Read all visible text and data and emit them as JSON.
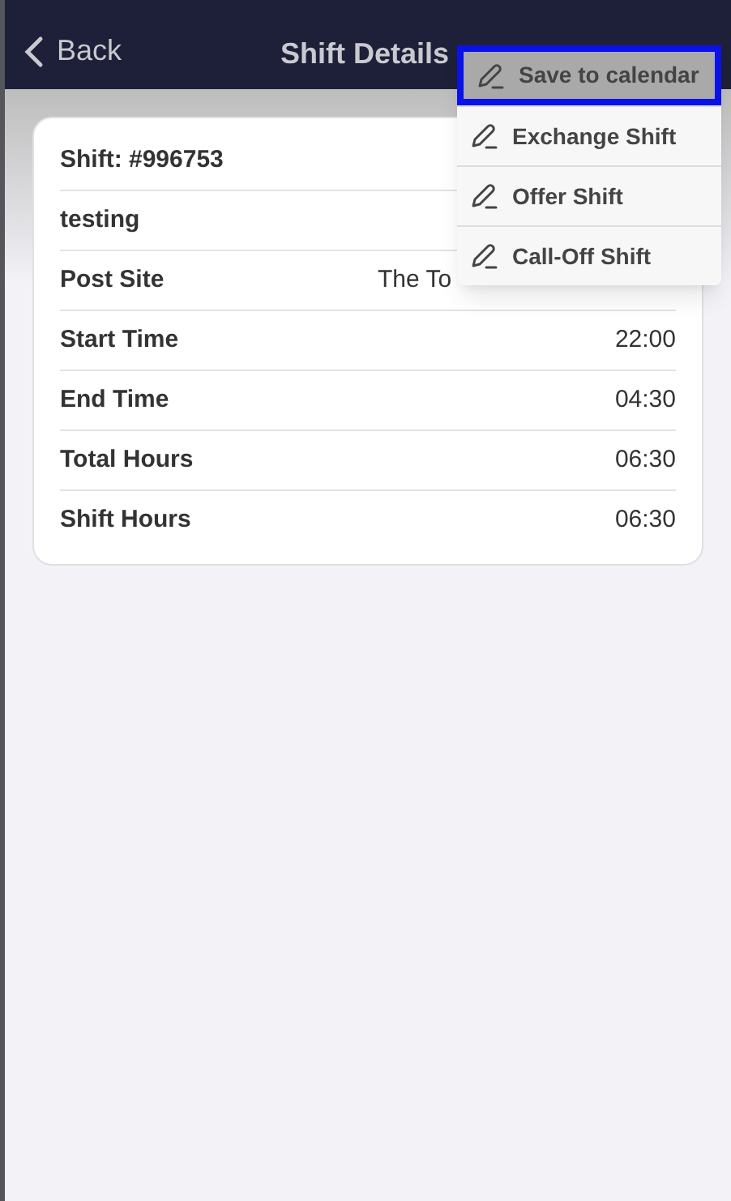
{
  "header": {
    "back": "Back",
    "title": "Shift Details"
  },
  "card": {
    "title": "Shift: #996753",
    "subtitle": "testing",
    "rows": [
      {
        "label": "Post Site",
        "value": "The To",
        "kind": "cut"
      },
      {
        "label": "Start Time",
        "value": "22:00",
        "kind": "right"
      },
      {
        "label": "End Time",
        "value": "04:30",
        "kind": "right"
      },
      {
        "label": "Total Hours",
        "value": "06:30",
        "kind": "right"
      },
      {
        "label": "Shift Hours",
        "value": "06:30",
        "kind": "right"
      }
    ]
  },
  "menu": [
    {
      "label": "Save to calendar",
      "selected": true
    },
    {
      "label": "Exchange Shift",
      "selected": false
    },
    {
      "label": "Offer Shift",
      "selected": false
    },
    {
      "label": "Call-Off Shift",
      "selected": false
    }
  ]
}
